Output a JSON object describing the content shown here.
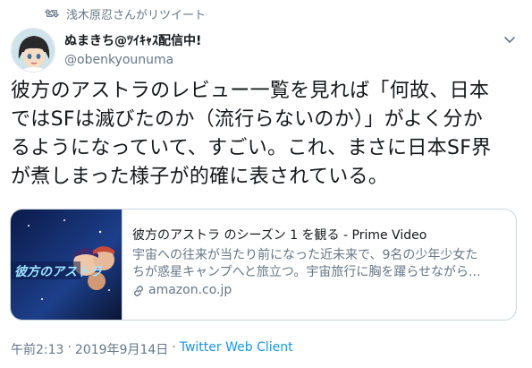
{
  "retweet": {
    "text": "浅木原忍さんがリツイート"
  },
  "user": {
    "display_name": "ぬまきち@ﾂｲｷｬｽ配信中!",
    "screen_name": "@obenkyounuma"
  },
  "tweet": {
    "lines": [
      "彼方のアストラのレビュー一覧を見れば「何故、日本",
      "ではSFは滅びたのか（流行らないのか）」がよく分か",
      "るようになっていて、すごい。これ、まさに日本SF界",
      "が煮しまった様子が的確に表されている。"
    ]
  },
  "card": {
    "image_text": "彼方のアストラ",
    "title": "彼方のアストラ のシーズン 1 を観る - Prime Video",
    "desc_lines": [
      "宇宙への往来が当たり前になった近未来で、9名の少年少女た",
      "ちが惑星キャンプへと旅立つ。宇宙旅行に胸を躍らせながら..."
    ],
    "domain": "amazon.co.jp"
  },
  "meta": {
    "time": "午前2:13",
    "sep": "·",
    "date": "2019年9月14日",
    "source": "Twitter Web Client"
  },
  "icons": {
    "retweet": "retweet-icon",
    "chevron": "chevron-down-icon",
    "link": "link-icon"
  },
  "colors": {
    "link": "#1b95e0",
    "secondary": "#657786",
    "text": "#14171a",
    "border": "#ccd6dd"
  }
}
